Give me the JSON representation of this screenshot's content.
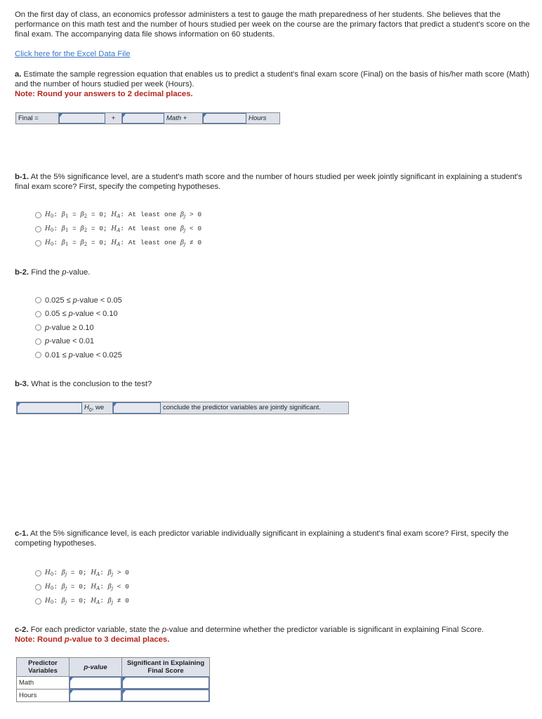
{
  "intro": {
    "text": "On the first day of class, an economics professor administers a test to gauge the math preparedness of her students. She believes that the performance on this math test and the number of hours studied per week on the course are the primary factors that predict a student's score on the final exam. The accompanying data file shows information on 60 students.",
    "link": "Click here for the Excel Data File"
  },
  "part_a": {
    "label": "a.",
    "text": " Estimate the sample regression equation that enables us to predict a student's final exam score (Final) on the basis of his/her math score (Math) and the number of hours studied per week (Hours).",
    "note": "Note: Round your answers to 2 decimal places.",
    "equation": {
      "lhs": "Final =",
      "plus": "+",
      "math": "Math +",
      "hours": "Hours",
      "intercept_value": "",
      "math_coef_value": "",
      "hours_coef_value": ""
    }
  },
  "part_b1": {
    "label": "b-1.",
    "text": " At the 5% significance level, are a student's math score and the number of hours studied per week jointly significant in explaining a student's final exam score? First, specify the competing hypotheses.",
    "options": [
      {
        "h0": "β1 = β2 = 0;",
        "ha": "At least one βj > 0"
      },
      {
        "h0": "β1 = β2 = 0;",
        "ha": "At least one βj < 0"
      },
      {
        "h0": "β1 = β2 = 0;",
        "ha": "At least one βj ≠ 0"
      }
    ]
  },
  "part_b2": {
    "label": "b-2.",
    "text_pre": " Find the ",
    "text_it": "p",
    "text_post": "-value.",
    "options": [
      {
        "pre": "0.025 ≤ ",
        "post": "-value < 0.05"
      },
      {
        "pre": "0.05 ≤ ",
        "post": "-value < 0.10"
      },
      {
        "pre": "",
        "post": "-value ≥ 0.10"
      },
      {
        "pre": "",
        "post": "-value < 0.01"
      },
      {
        "pre": "0.01 ≤ ",
        "post": "-value < 0.025"
      }
    ],
    "p": "p"
  },
  "part_b3": {
    "label": "b-3.",
    "text": " What is the conclusion to the test?",
    "h0_we": ", we",
    "conclusion": "conclude the predictor variables are jointly significant.",
    "decision_value": "",
    "verb_value": ""
  },
  "part_c1": {
    "label": "c-1.",
    "text": " At the 5% significance level, is each predictor variable individually significant in explaining a student's final exam score? First, specify the competing hypotheses.",
    "options": [
      {
        "h0": "βj = 0;",
        "ha": "βj > 0"
      },
      {
        "h0": "βj = 0;",
        "ha": "βj < 0"
      },
      {
        "h0": "βj = 0;",
        "ha": "βj ≠ 0"
      }
    ]
  },
  "part_c2": {
    "label": "c-2.",
    "text_pre": " For each predictor variable, state the ",
    "text_post": "-value and determine whether the predictor variable is significant in explaining Final Score.",
    "note_pre": "Note: Round ",
    "note_post": "-value to 3 decimal places.",
    "p": "p",
    "table": {
      "headers": [
        "Predictor Variables",
        "p-value",
        "Significant in Explaining Final Score"
      ],
      "rows": [
        {
          "variable": "Math",
          "p_value": "",
          "significant": ""
        },
        {
          "variable": "Hours",
          "p_value": "",
          "significant": ""
        }
      ]
    }
  }
}
